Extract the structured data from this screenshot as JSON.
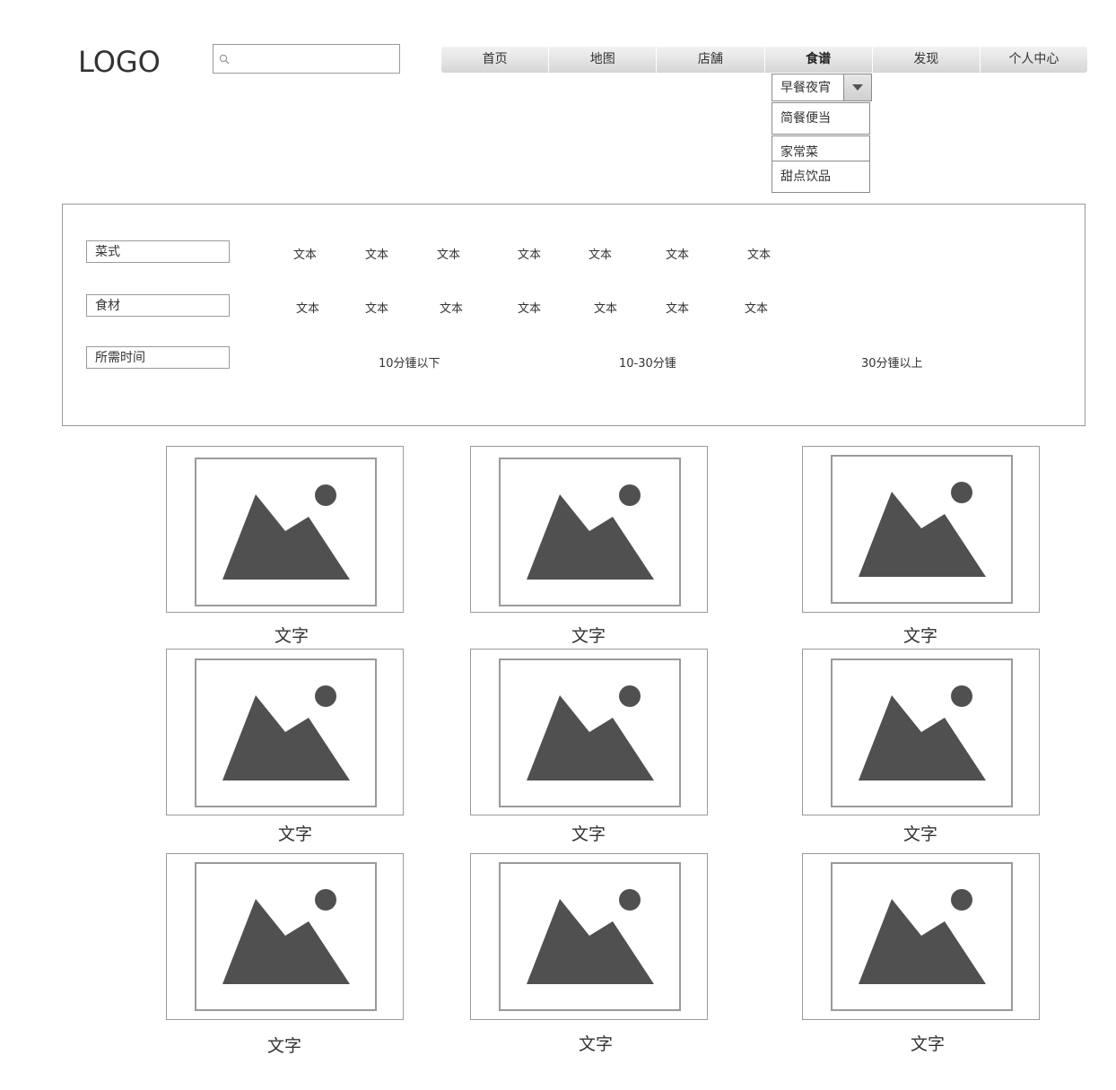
{
  "header": {
    "logo": "LOGO",
    "search": {
      "value": "",
      "placeholder": ""
    }
  },
  "nav": {
    "items": [
      {
        "label": "首页"
      },
      {
        "label": "地图"
      },
      {
        "label": "店舗"
      },
      {
        "label": "食谱",
        "active": true
      },
      {
        "label": "发现"
      },
      {
        "label": "个人中心"
      }
    ]
  },
  "dropdown": {
    "selected": "早餐夜宵",
    "options": [
      "简餐便当",
      "家常菜",
      "甜点饮品"
    ]
  },
  "filters": {
    "cuisine": {
      "label": "菜式",
      "options": [
        "文本",
        "文本",
        "文本",
        "文本",
        "文本",
        "文本",
        "文本"
      ]
    },
    "ingredient": {
      "label": "食材",
      "options": [
        "文本",
        "文本",
        "文本",
        "文本",
        "文本",
        "文本",
        "文本"
      ]
    },
    "time": {
      "label": "所需时间",
      "options": [
        "10分锺以下",
        "10-30分锺",
        "30分锺以上"
      ]
    }
  },
  "cards": [
    {
      "caption": "文字"
    },
    {
      "caption": "文字"
    },
    {
      "caption": "文字"
    },
    {
      "caption": "文字"
    },
    {
      "caption": "文字"
    },
    {
      "caption": "文字"
    },
    {
      "caption": "文字"
    },
    {
      "caption": "文字"
    },
    {
      "caption": "文字"
    }
  ],
  "icons": {
    "search": "search-icon",
    "dropdown_arrow": "caret-down-icon",
    "image_placeholder": "image-placeholder-icon"
  },
  "colors": {
    "placeholder_fill": "#505050",
    "border": "#9a9a9a",
    "nav_gradient_top": "#f2f2f2",
    "nav_gradient_bottom": "#d6d6d6"
  }
}
